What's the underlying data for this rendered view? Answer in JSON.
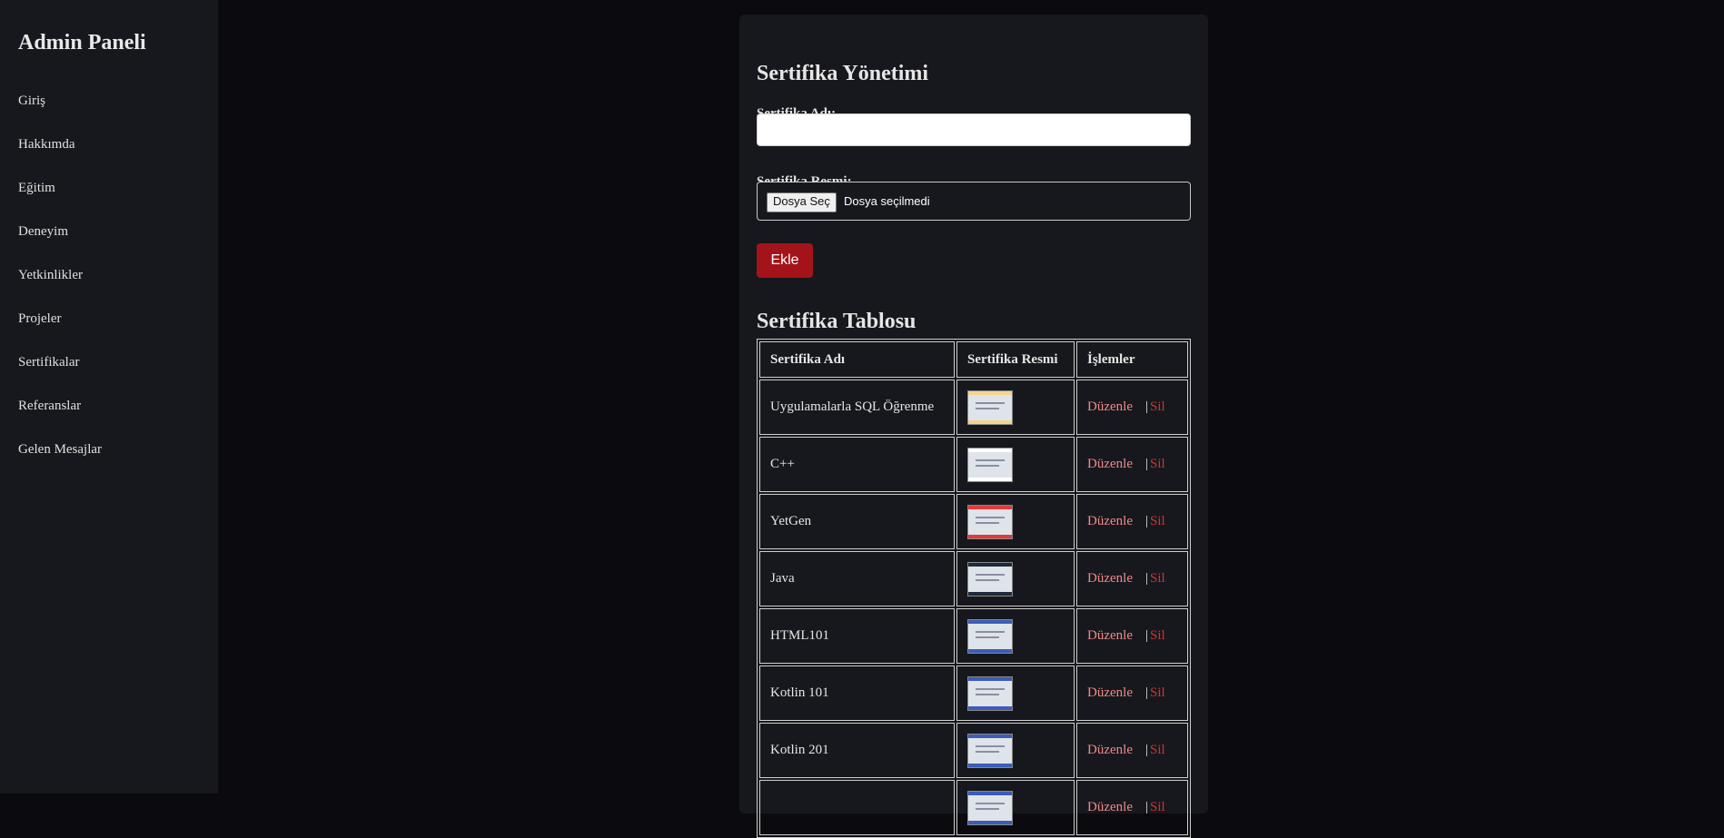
{
  "sidebar": {
    "title": "Admin Paneli",
    "items": [
      {
        "label": "Giriş"
      },
      {
        "label": "Hakkımda"
      },
      {
        "label": "Eğitim"
      },
      {
        "label": "Deneyim"
      },
      {
        "label": "Yetkinlikler"
      },
      {
        "label": "Projeler"
      },
      {
        "label": "Sertifikalar"
      },
      {
        "label": "Referanslar"
      },
      {
        "label": "Gelen Mesajlar"
      }
    ]
  },
  "form": {
    "title": "Sertifika Yönetimi",
    "name_label": "Sertifika Adı:",
    "name_value": "",
    "image_label": "Sertifika Resmi:",
    "file_button": "Dosya Seç",
    "file_status": "Dosya seçilmedi",
    "submit_label": "Ekle"
  },
  "table": {
    "title": "Sertifika Tablosu",
    "headers": [
      "Sertifika Adı",
      "Sertifika Resmi",
      "İşlemler"
    ],
    "edit_label": "Düzenle",
    "separator": "|",
    "delete_label": "Sil",
    "rows": [
      {
        "name": "Uygulamalarla SQL Öğrenme",
        "thumb_color": "#f5d58a"
      },
      {
        "name": "C++",
        "thumb_color": "#ffffff"
      },
      {
        "name": "YetGen",
        "thumb_color": "#e23a3a"
      },
      {
        "name": "Java",
        "thumb_color": "#1f2a3a"
      },
      {
        "name": "HTML101",
        "thumb_color": "#3b5db8"
      },
      {
        "name": "Kotlin 101",
        "thumb_color": "#3b5db8"
      },
      {
        "name": "Kotlin 201",
        "thumb_color": "#3b5db8"
      },
      {
        "name": "",
        "thumb_color": "#3b5db8"
      }
    ]
  },
  "colors": {
    "accent": "#a3141a",
    "link_edit": "#f08a8a",
    "link_delete": "#d13333",
    "background": "#0b0b0f",
    "panel": "#17181d"
  }
}
